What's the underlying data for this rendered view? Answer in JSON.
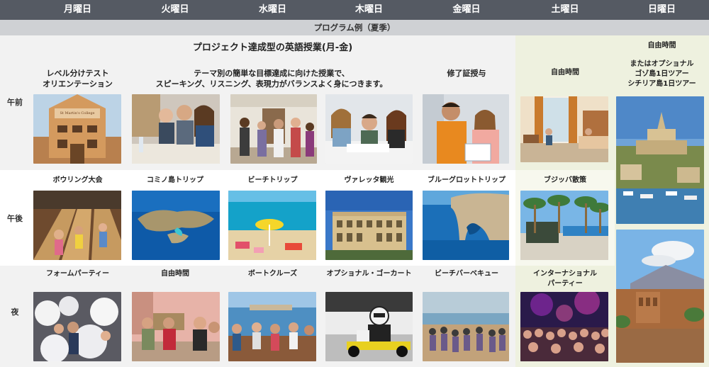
{
  "days": [
    "月曜日",
    "火曜日",
    "水曜日",
    "木曜日",
    "金曜日",
    "土曜日",
    "日曜日"
  ],
  "subtitle": "プログラム例（夏季）",
  "periods": {
    "morning": "午前",
    "afternoon": "午後",
    "evening": "夜"
  },
  "morning": {
    "banner": "プロジェクト達成型の英語授業(月-金)",
    "mon_line1": "レベル分けテスト",
    "mon_line2": "オリエンテーション",
    "tue_wed_line1": "テーマ別の簡単な目標達成に向けた授業で、",
    "tue_wed_line2": "スピーキング、リスニング、表現力がバランスよく身につきます。",
    "fri": "修了証授与",
    "sat": "自由時間",
    "sun_line1": "自由時間",
    "sun_line2": "またはオプショナル",
    "sun_line3": "ゴゾ島1日ツアー",
    "sun_line4": "シチリア島1日ツアー",
    "college_sign": "St Martin's College"
  },
  "afternoon": {
    "mon": "ボウリング大会",
    "tue": "コミノ島トリップ",
    "wed": "ビーチトリップ",
    "thu": "ヴァレッタ観光",
    "fri": "ブルーグロットトリップ",
    "sat": "ブジッバ散策"
  },
  "evening": {
    "mon": "フォームパーティー",
    "tue": "自由時間",
    "wed": "ボートクルーズ",
    "thu": "オプショナル・ゴーカート",
    "fri": "ビーチバーベキュー",
    "sat_line1": "インターナショナル",
    "sat_line2": "パーティー"
  },
  "colors": {
    "header": "#555a63",
    "subheader": "#cfd1d4",
    "weekday_bg": "#f2f2f2",
    "weekend_bg": "#eef1df"
  }
}
